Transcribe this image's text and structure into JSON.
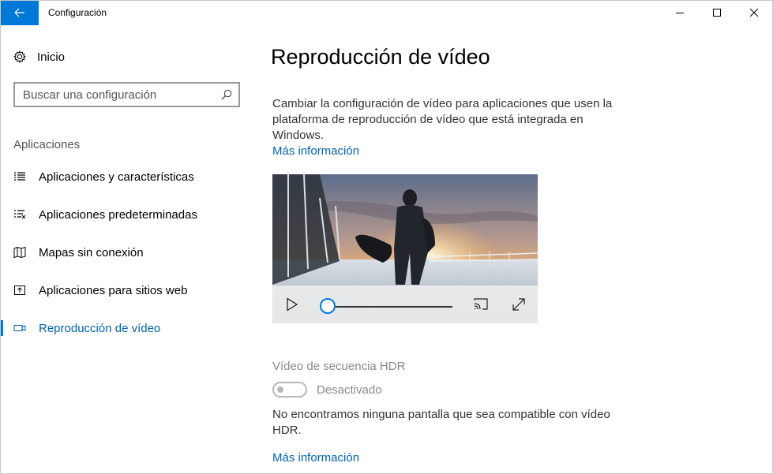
{
  "window": {
    "title": "Configuración"
  },
  "sidebar": {
    "home_label": "Inicio",
    "search_placeholder": "Buscar una configuración",
    "section_header": "Aplicaciones",
    "items": [
      {
        "label": "Aplicaciones y características",
        "icon": "list-icon"
      },
      {
        "label": "Aplicaciones predeterminadas",
        "icon": "default-apps-icon"
      },
      {
        "label": "Mapas sin conexión",
        "icon": "map-icon"
      },
      {
        "label": "Aplicaciones para sitios web",
        "icon": "web-apps-icon"
      },
      {
        "label": "Reproducción de vídeo",
        "icon": "video-icon",
        "active": true
      }
    ]
  },
  "main": {
    "title": "Reproducción de vídeo",
    "description": "Cambiar la configuración de vídeo para aplicaciones que usen la plataforma de reproducción de vídeo que está integrada en Windows.",
    "more_info_label": "Más información",
    "video_progress": 0.0,
    "hdr": {
      "title": "Vídeo de secuencia HDR",
      "toggle_state_label": "Desactivado",
      "toggle_on": false,
      "note": "No encontramos ninguna pantalla que sea compatible con vídeo HDR.",
      "more_info_label": "Más información"
    }
  },
  "colors": {
    "accent": "#0078d7",
    "link": "#0063b1"
  }
}
